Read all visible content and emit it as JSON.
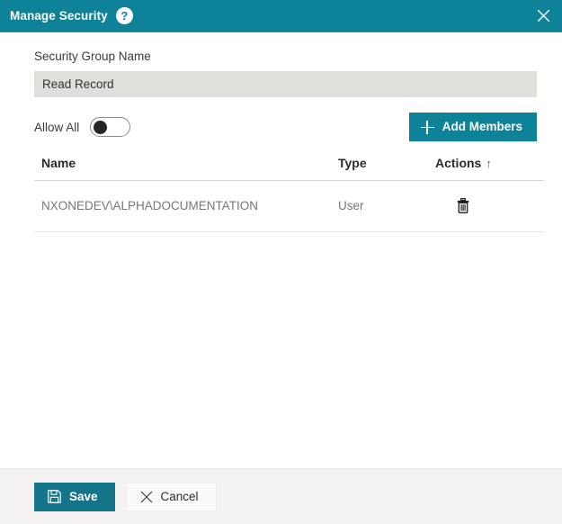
{
  "titlebar": {
    "title": "Manage Security",
    "help_icon": "help-circle-icon",
    "help_glyph": "?",
    "close_icon": "close-icon",
    "background_color": "#0e8299"
  },
  "form": {
    "group_name_label": "Security Group Name",
    "group_name_value": "Read Record",
    "group_name_placeholder": "Security Group Name",
    "allow_all_label": "Allow All",
    "allow_all_state": "off",
    "add_members_label": "Add Members",
    "add_members_icon": "plus-icon"
  },
  "table": {
    "columns": [
      {
        "label": "Name",
        "sort": ""
      },
      {
        "label": "Type",
        "sort": ""
      },
      {
        "label": "Actions",
        "sort": "↑"
      }
    ],
    "rows": [
      {
        "name": "NXONEDEV\\ALPHADOCUMENTATION",
        "type": "User",
        "action_icon": "trash-icon"
      }
    ]
  },
  "footer": {
    "save_label": "Save",
    "save_icon": "save-disk-icon",
    "cancel_label": "Cancel",
    "cancel_icon": "close-x-icon"
  },
  "colors": {
    "accent": "#0e8299",
    "save_button": "#13748a",
    "input_background": "#dfdedb",
    "footer_background": "#f4f2f0",
    "row_border": "#dde9ef"
  }
}
